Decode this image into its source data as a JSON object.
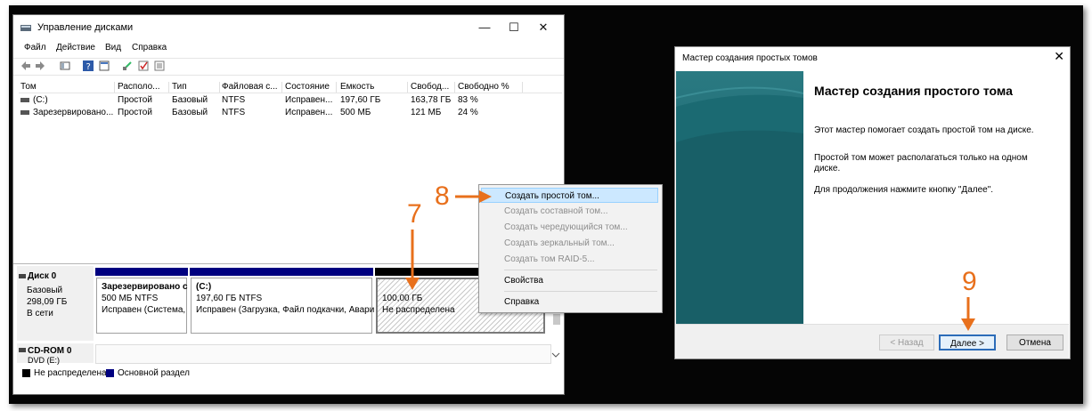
{
  "disk_management": {
    "title": "Управление дисками",
    "window_controls": {
      "minimize": "—",
      "maximize": "☐",
      "close": "✕"
    },
    "menu": [
      "Файл",
      "Действие",
      "Вид",
      "Справка"
    ],
    "columns": [
      "Том",
      "Располо...",
      "Тип",
      "Файловая с...",
      "Состояние",
      "Емкость",
      "Свобод...",
      "Свободно %"
    ],
    "volumes": [
      [
        "(C:)",
        "Простой",
        "Базовый",
        "NTFS",
        "Исправен...",
        "197,60 ГБ",
        "163,78 ГБ",
        "83 %"
      ],
      [
        "Зарезервировано...",
        "Простой",
        "Базовый",
        "NTFS",
        "Исправен...",
        "500 МБ",
        "121 МБ",
        "24 %"
      ]
    ],
    "disk0": {
      "name": "Диск 0",
      "type": "Базовый",
      "size": "298,09 ГБ",
      "status": "В сети",
      "partitions": [
        {
          "name": "Зарезервировано с",
          "size": "500 МБ NTFS",
          "status": "Исправен (Система,"
        },
        {
          "name": "(C:)",
          "size": "197,60 ГБ NTFS",
          "status": "Исправен (Загрузка, Файл подкачки, Авари"
        },
        {
          "name": "",
          "size": "100,00 ГБ",
          "status": "Не распределена"
        }
      ]
    },
    "cdrom": {
      "name": "CD-ROM 0",
      "sub": "DVD (E:)"
    },
    "legend": {
      "unallocated": "Не распределена",
      "primary": "Основной раздел"
    }
  },
  "context_menu": {
    "items": [
      {
        "label": "Создать простой том...",
        "enabled": true,
        "highlighted": true
      },
      {
        "label": "Создать составной том...",
        "enabled": false
      },
      {
        "label": "Создать чередующийся том...",
        "enabled": false
      },
      {
        "label": "Создать зеркальный том...",
        "enabled": false
      },
      {
        "label": "Создать том RAID-5...",
        "enabled": false
      },
      {
        "label": "Свойства",
        "enabled": true
      },
      {
        "label": "Справка",
        "enabled": true
      }
    ]
  },
  "wizard": {
    "title": "Мастер создания простых томов",
    "heading": "Мастер создания простого тома",
    "p1": "Этот мастер помогает создать простой том на диске.",
    "p2a": "Простой том может располагаться только на одном",
    "p2b": "диске.",
    "p3": "Для продолжения нажмите кнопку \"Далее\".",
    "back": "< Назад",
    "next": "Далее >",
    "cancel": "Отмена",
    "close": "✕"
  },
  "annotations": {
    "step7": "7",
    "step8": "8",
    "step9": "9"
  },
  "colors": {
    "annotation": "#e8701c",
    "primary_partition": "#000080",
    "unallocated": "#000000",
    "menu_highlight": "#cce8ff"
  }
}
